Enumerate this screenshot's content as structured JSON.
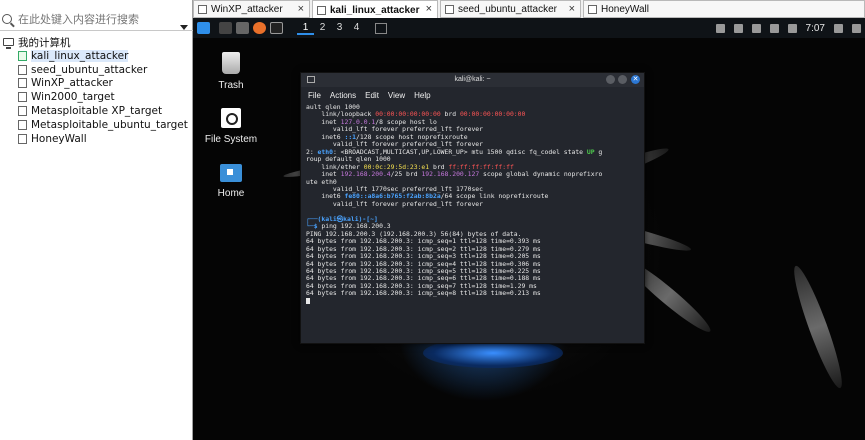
{
  "sidebar": {
    "search_placeholder": "在此处键入内容进行搜索",
    "root_label": "我的计算机",
    "items": [
      {
        "label": "kali_linux_attacker"
      },
      {
        "label": "seed_ubuntu_attacker"
      },
      {
        "label": "WinXP_attacker"
      },
      {
        "label": "Win2000_target"
      },
      {
        "label": "Metasploitable XP_target"
      },
      {
        "label": "Metasploitable_ubuntu_target"
      },
      {
        "label": "HoneyWall"
      }
    ]
  },
  "tabs": [
    {
      "label": "WinXP_attacker"
    },
    {
      "label": "kali_linux_attacker"
    },
    {
      "label": "seed_ubuntu_attacker"
    },
    {
      "label": "HoneyWall"
    }
  ],
  "tab_close": "×",
  "panel": {
    "workspaces": [
      "1",
      "2",
      "3",
      "4"
    ],
    "clock": "7:07"
  },
  "desktop": {
    "trash_label": "Trash",
    "filesystem_label": "File System",
    "home_label": "Home"
  },
  "terminal": {
    "title": "kali@kali: ~",
    "close_glyph": "✕",
    "menu": [
      "File",
      "Actions",
      "Edit",
      "View",
      "Help"
    ],
    "ping_cmd": "ping 192.168.200.3",
    "ping_header": "PING 192.168.200.3 (192.168.200.3) 56(84) bytes of data.",
    "ping_lines": [
      "64 bytes from 192.168.200.3: icmp_seq=1 ttl=128 time=0.393 ms",
      "64 bytes from 192.168.200.3: icmp_seq=2 ttl=128 time=0.279 ms",
      "64 bytes from 192.168.200.3: icmp_seq=3 ttl=128 time=0.205 ms",
      "64 bytes from 192.168.200.3: icmp_seq=4 ttl=128 time=0.306 ms",
      "64 bytes from 192.168.200.3: icmp_seq=5 ttl=128 time=0.225 ms",
      "64 bytes from 192.168.200.3: icmp_seq=6 ttl=128 time=0.188 ms",
      "64 bytes from 192.168.200.3: icmp_seq=7 ttl=128 time=1.29 ms",
      "64 bytes from 192.168.200.3: icmp_seq=8 ttl=128 time=0.213 ms"
    ]
  },
  "colors": {
    "accent": "#2f8fea",
    "terminal_bg": "#23262d"
  }
}
